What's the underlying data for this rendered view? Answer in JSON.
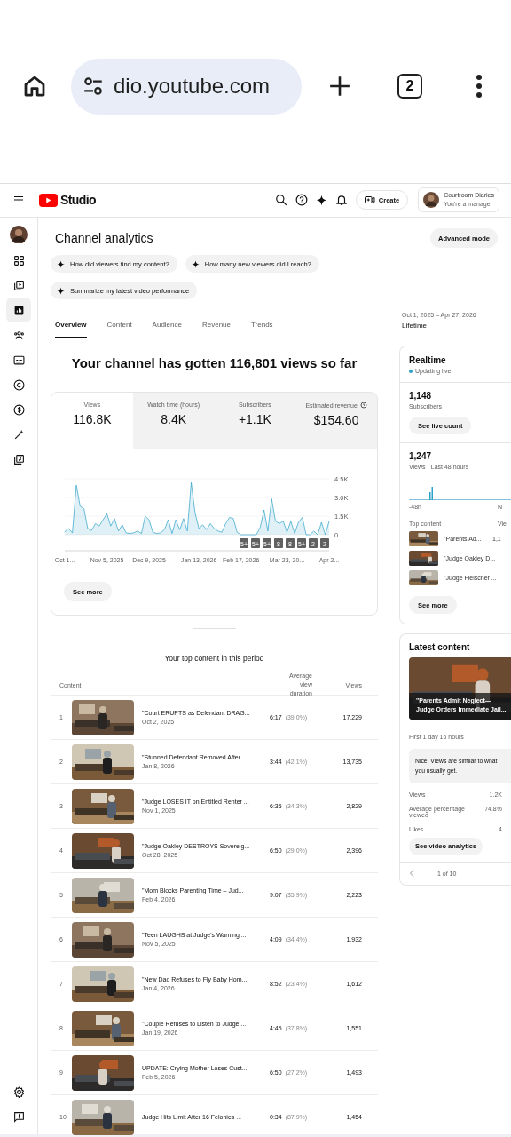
{
  "browser": {
    "url": "dio.youtube.com",
    "tab_count": "2"
  },
  "header": {
    "logo": "Studio",
    "create": "Create",
    "account": {
      "name": "Courtroom Diaries",
      "role": "You're a manager"
    }
  },
  "rail": {
    "items": [
      {
        "kind": "dashboard",
        "selected": false
      },
      {
        "kind": "content",
        "selected": false
      },
      {
        "kind": "analytics",
        "selected": true
      },
      {
        "kind": "community",
        "selected": false
      },
      {
        "kind": "subtitles",
        "selected": false
      },
      {
        "kind": "copyright",
        "selected": false
      },
      {
        "kind": "earn",
        "selected": false
      },
      {
        "kind": "customization",
        "selected": false
      },
      {
        "kind": "audio",
        "selected": false
      }
    ],
    "footer": [
      {
        "kind": "settings"
      },
      {
        "kind": "feedback"
      }
    ]
  },
  "page": {
    "title": "Channel analytics",
    "advanced_mode": "Advanced mode",
    "prompts": [
      "How did viewers find my content?",
      "How many new viewers did I reach?",
      "Summarize my latest video performance"
    ],
    "tabs": [
      {
        "label": "Overview",
        "selected": true
      },
      {
        "label": "Content",
        "selected": false
      },
      {
        "label": "Audience",
        "selected": false
      },
      {
        "label": "Revenue",
        "selected": false
      },
      {
        "label": "Trends",
        "selected": false
      }
    ],
    "date_range": "Oct 1, 2025 – Apr 27, 2026",
    "period": "Lifetime"
  },
  "overview": {
    "headline": "Your channel has gotten 116,801 views so far",
    "metrics": [
      {
        "label": "Views",
        "value": "116.8K",
        "selected": true,
        "info": false
      },
      {
        "label": "Watch time (hours)",
        "value": "8.4K",
        "selected": false,
        "info": false
      },
      {
        "label": "Subscribers",
        "value": "+1.1K",
        "selected": false,
        "info": false
      },
      {
        "label": "Estimated revenue",
        "value": "$154.60",
        "selected": false,
        "info": true
      }
    ],
    "chart_data": {
      "type": "area",
      "categories": [
        "Oct 1...",
        null,
        null,
        null,
        null,
        null,
        null,
        null,
        null,
        null,
        null,
        "Nov 5, 2025",
        null,
        null,
        null,
        null,
        null,
        null,
        null,
        null,
        null,
        null,
        "Dec 9, 2025",
        null,
        null,
        null,
        null,
        null,
        null,
        null,
        null,
        null,
        null,
        null,
        null,
        "Jan 13, 2026",
        null,
        null,
        null,
        null,
        null,
        null,
        null,
        null,
        null,
        null,
        "Feb 17, 2026",
        null,
        null,
        null,
        null,
        null,
        null,
        null,
        null,
        null,
        null,
        null,
        "Mar 23, 20...",
        null,
        null,
        null,
        null,
        null,
        null,
        null,
        null,
        null,
        null,
        "Apr 2..."
      ],
      "values": [
        250,
        500,
        150,
        4000,
        2300,
        2100,
        500,
        350,
        900,
        700,
        1200,
        1700,
        700,
        1300,
        300,
        800,
        150,
        100,
        150,
        300,
        100,
        1500,
        1200,
        200,
        100,
        150,
        400,
        1200,
        100,
        1200,
        400,
        1300,
        300,
        4200,
        1800,
        500,
        800,
        400,
        900,
        500,
        300,
        200,
        900,
        1400,
        1300,
        200,
        0,
        0,
        0,
        0,
        0,
        600,
        2000,
        300,
        2900,
        1100,
        900,
        1100,
        200,
        1100,
        100,
        1000,
        1400,
        0,
        0,
        300,
        0,
        1000,
        0,
        1100
      ],
      "ylim": [
        0,
        4500
      ],
      "yticks": [
        {
          "value": 0,
          "label": "0"
        },
        {
          "value": 1500,
          "label": "1.5K"
        },
        {
          "value": 3000,
          "label": "3.0K"
        },
        {
          "value": 4500,
          "label": "4.5K"
        }
      ],
      "annotations": [
        "5+",
        "5+",
        "5+",
        "8",
        "8",
        "5+",
        "2",
        "2"
      ]
    },
    "see_more": "See more"
  },
  "top_content": {
    "title": "Your top content in this period",
    "columns": [
      "Content",
      "Average view duration",
      "Views"
    ],
    "rows": [
      {
        "rank": "1",
        "title": "\"Court ERUPTS as Defendant DRAG...",
        "date": "Oct 2, 2025",
        "duration": "6:17",
        "percent": "(39.0%)",
        "views": "17,229"
      },
      {
        "rank": "2",
        "title": "\"Stunned Defendant Removed After ...",
        "date": "Jan 8, 2026",
        "duration": "3:44",
        "percent": "(42.1%)",
        "views": "13,735"
      },
      {
        "rank": "3",
        "title": "\"Judge LOSES IT on Entitled Renter ...",
        "date": "Nov 1, 2025",
        "duration": "6:35",
        "percent": "(34.3%)",
        "views": "2,829"
      },
      {
        "rank": "4",
        "title": "\"Judge Oakley DESTROYS Sovereig...",
        "date": "Oct 28, 2025",
        "duration": "6:50",
        "percent": "(29.0%)",
        "views": "2,396"
      },
      {
        "rank": "5",
        "title": "\"Mom Blocks Parenting Time – Jud...",
        "date": "Feb 4, 2026",
        "duration": "9:07",
        "percent": "(35.9%)",
        "views": "2,223"
      },
      {
        "rank": "6",
        "title": "\"Teen LAUGHS at Judge's Warning ...",
        "date": "Nov 5, 2025",
        "duration": "4:09",
        "percent": "(34.4%)",
        "views": "1,932"
      },
      {
        "rank": "7",
        "title": "\"New Dad Refuses to Fly Baby Hom...",
        "date": "Jan 4, 2026",
        "duration": "8:52",
        "percent": "(23.4%)",
        "views": "1,612"
      },
      {
        "rank": "8",
        "title": "\"Couple Refuses to Listen to Judge ...",
        "date": "Jan 19, 2026",
        "duration": "4:45",
        "percent": "(37.8%)",
        "views": "1,551"
      },
      {
        "rank": "9",
        "title": "UPDATE: Crying Mother Loses Cust...",
        "date": "Feb 5, 2026",
        "duration": "6:50",
        "percent": "(27.2%)",
        "views": "1,493"
      },
      {
        "rank": "10",
        "title": "Judge Hits Limit After 16 Felonies ...",
        "duration": "0:34",
        "percent": "(87.9%)",
        "views": "1,454"
      }
    ]
  },
  "realtime": {
    "title": "Realtime",
    "status": "Updating live",
    "subscribers": "1,148",
    "subscribers_label": "Subscribers",
    "live_count": "See live count",
    "views": "1,247",
    "views_label": "Views · Last 48 hours",
    "axis_start": "-48h",
    "axis_end": "N",
    "top_header": "Top content",
    "views_header": "Vie",
    "items": [
      {
        "title": "\"Parents Ad...",
        "views": "1,1"
      },
      {
        "title": "\"Judge Oakley D..."
      },
      {
        "title": "\"Judge Fleischer ..."
      }
    ],
    "see_more": "See more"
  },
  "latest": {
    "title": "Latest content",
    "video_title": "\"Parents Admit Neglect— Judge Orders Immediate Jail...",
    "age": "First 1 day 16 hours",
    "insight": "Nice! Views are similar to what you usually get.",
    "stats": [
      {
        "label": "Views",
        "value": "1.2K"
      },
      {
        "label": "Average percentage viewed",
        "value": "74.8%"
      },
      {
        "label": "Likes",
        "value": "4"
      }
    ],
    "button": "See video analytics",
    "pager": "1 of 10"
  }
}
